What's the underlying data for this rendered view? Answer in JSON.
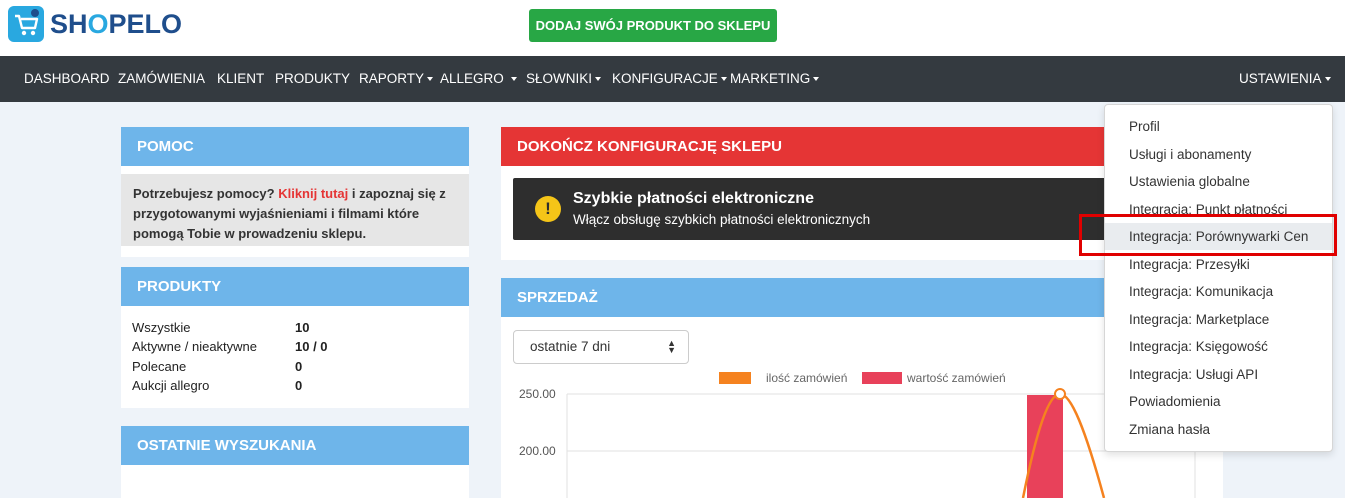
{
  "brand": {
    "logo_text_1": "SH",
    "logo_text_2": "O",
    "logo_text_3": "PELO",
    "accent": "#29a8e0"
  },
  "header": {
    "add_product_label": "DODAJ SWÓJ PRODUKT DO SKLEPU"
  },
  "nav": {
    "items": [
      {
        "label": "DASHBOARD"
      },
      {
        "label": "ZAMÓWIENIA"
      },
      {
        "label": "KLIENT"
      },
      {
        "label": "PRODUKTY"
      },
      {
        "label": "RAPORTY"
      },
      {
        "label": "ALLEGRO"
      },
      {
        "label": "SŁOWNIKI"
      },
      {
        "label": "KONFIGURACJE"
      },
      {
        "label": "MARKETING"
      }
    ],
    "settings_label": "USTAWIENIA"
  },
  "help": {
    "title": "POMOC",
    "text_before": "Potrzebujesz pomocy? ",
    "link": "Kliknij tutaj",
    "text_after": " i zapoznaj się z przygotowanymi wyjaśnieniami i filmami które pomogą Tobie w prowadzeniu sklepu."
  },
  "products": {
    "title": "PRODUKTY",
    "rows": [
      {
        "label": "Wszystkie",
        "value": "10"
      },
      {
        "label": "Aktywne / nieaktywne",
        "value": "10 / 0"
      },
      {
        "label": "Polecane",
        "value": "0"
      },
      {
        "label": "Aukcji allegro",
        "value": "0"
      }
    ]
  },
  "searches": {
    "title": "OSTATNIE WYSZUKANIA"
  },
  "setup": {
    "title": "DOKOŃCZ KONFIGURACJĘ SKLEPU",
    "alert_title": "Szybkie płatności elektroniczne",
    "alert_sub": "Włącz obsługę szybkich płatności elektronicznych"
  },
  "sales": {
    "title": "SPRZEDAŻ",
    "period_select": "ostatnie 7 dni"
  },
  "chart_data": {
    "type": "bar",
    "series": [
      {
        "name": "ilość zamówień",
        "color": "#f5821f"
      },
      {
        "name": "wartość zamówień",
        "color": "#e8415a"
      }
    ],
    "y_ticks": [
      "250.00",
      "200.00"
    ],
    "colors": {
      "line": "#f5821f",
      "bar": "#e8415a"
    }
  },
  "settings_menu": {
    "items": [
      {
        "label": "Profil"
      },
      {
        "label": "Usługi i abonamenty"
      },
      {
        "label": "Ustawienia globalne"
      },
      {
        "label": "Integracja: Punkt płatności"
      },
      {
        "label": "Integracja: Porównywarki Cen"
      },
      {
        "label": "Integracja: Przesyłki"
      },
      {
        "label": "Integracja: Komunikacja"
      },
      {
        "label": "Integracja: Marketplace"
      },
      {
        "label": "Integracja: Księgowość"
      },
      {
        "label": "Integracja: Usługi API"
      },
      {
        "label": "Powiadomienia"
      },
      {
        "label": "Zmiana hasła"
      }
    ]
  }
}
